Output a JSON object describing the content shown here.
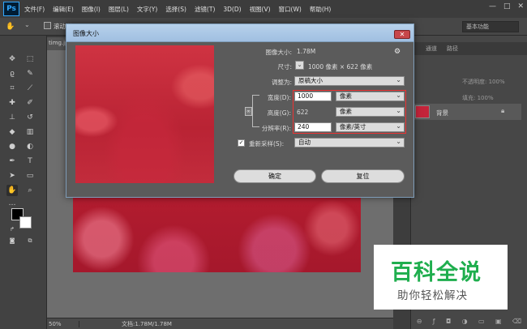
{
  "app": {
    "logo": "Ps"
  },
  "menu": [
    "文件(F)",
    "编辑(E)",
    "图像(I)",
    "图层(L)",
    "文字(Y)",
    "选择(S)",
    "滤镜(T)",
    "3D(D)",
    "视图(V)",
    "窗口(W)",
    "帮助(H)"
  ],
  "window_controls": {
    "minimize": "—",
    "restore": "□",
    "close": "✕"
  },
  "options": {
    "scroll_all_label": "滚动所",
    "workspace": "基本功能"
  },
  "document": {
    "tab_label": "timg.jp",
    "zoom": "50%",
    "info": "文档:1.78M/1.78M"
  },
  "panels": {
    "tabs": [
      "",
      "通道",
      "路径"
    ],
    "opacity_label": "不透明度: 100%",
    "fill_label": "填充: 100%",
    "layer_name": "背景"
  },
  "dialog": {
    "title": "图像大小",
    "close": "✕",
    "image_size_label": "图像大小:",
    "image_size_value": "1.78M",
    "dimensions_label": "尺寸:",
    "dimensions_value": "1000 像素 × 622 像素",
    "fit_to_label": "调整为:",
    "fit_to_value": "原稿大小",
    "width_label": "宽度(D):",
    "width_value": "1000",
    "width_unit": "像素",
    "height_label": "高度(G):",
    "height_value": "622",
    "height_unit": "像素",
    "resolution_label": "分辨率(R):",
    "resolution_value": "240",
    "resolution_unit": "像素/英寸",
    "resample_label": "重新采样(S):",
    "resample_value": "自动",
    "ok_label": "确定",
    "reset_label": "复位"
  },
  "watermark": {
    "title": "百科全说",
    "subtitle": "助你轻松解决"
  }
}
